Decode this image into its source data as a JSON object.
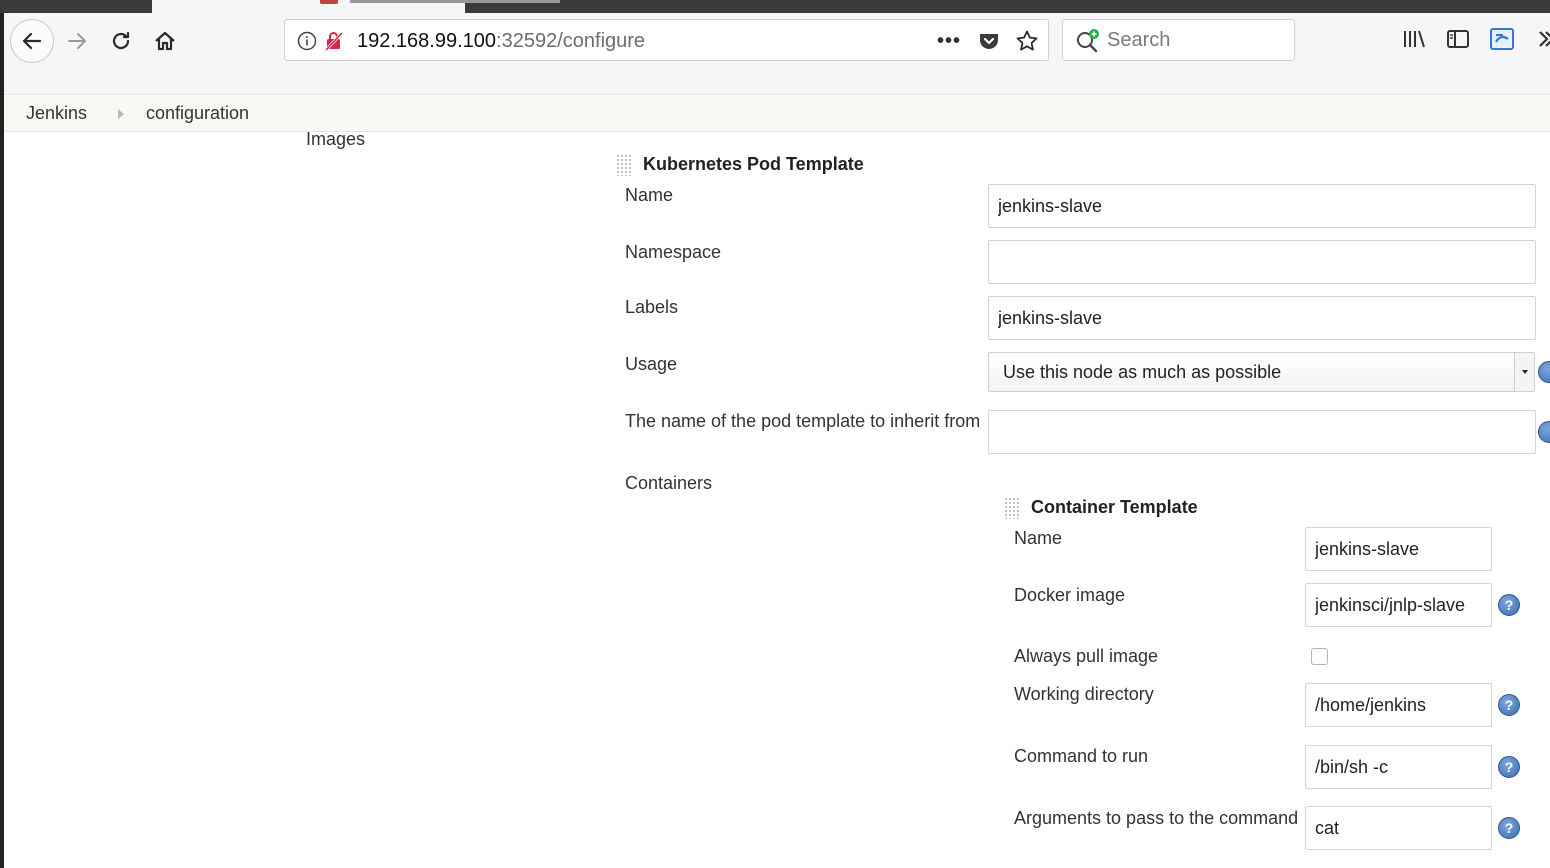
{
  "browser": {
    "url_host": "192.168.99.100",
    "url_path": ":32592/configure",
    "search_placeholder": "Search"
  },
  "breadcrumb": {
    "items": [
      "Jenkins",
      "configuration"
    ]
  },
  "page": {
    "section_title": "Images"
  },
  "pod_template": {
    "title": "Kubernetes Pod Template",
    "name_label": "Name",
    "name_value": "jenkins-slave",
    "namespace_label": "Namespace",
    "namespace_value": "",
    "labels_label": "Labels",
    "labels_value": "jenkins-slave",
    "usage_label": "Usage",
    "usage_value": "Use this node as much as possible",
    "inherit_label": "The name of the pod template to inherit from",
    "inherit_value": "",
    "containers_label": "Containers"
  },
  "container_template": {
    "title": "Container Template",
    "name_label": "Name",
    "name_value": "jenkins-slave",
    "docker_image_label": "Docker image",
    "docker_image_value": "jenkinsci/jnlp-slave",
    "always_pull_label": "Always pull image",
    "always_pull_checked": false,
    "workdir_label": "Working directory",
    "workdir_value": "/home/jenkins",
    "command_label": "Command to run",
    "command_value": "/bin/sh -c",
    "args_label": "Arguments to pass to the command",
    "args_value": "cat"
  },
  "icons": {
    "help": "?"
  },
  "colors": {
    "help_blue": "#3a6db5",
    "breadcrumb_bg": "#f7f9f4",
    "chrome_bg": "#f5f6f7"
  }
}
